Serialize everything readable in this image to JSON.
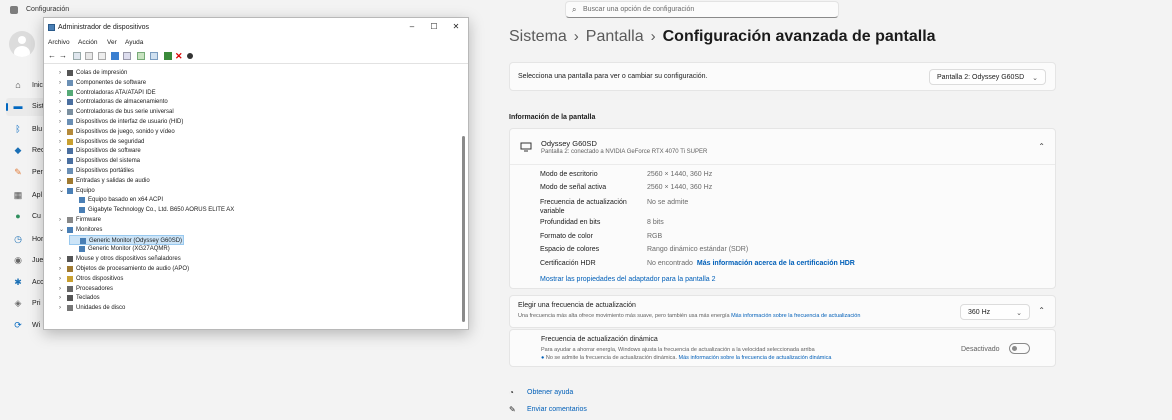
{
  "app": {
    "title": "Configuración"
  },
  "search": {
    "placeholder": "Buscar una opción de configuración"
  },
  "nav": [
    {
      "label": "Inic",
      "icon": "home-icon"
    },
    {
      "label": "Sist",
      "icon": "system-icon"
    },
    {
      "label": "Blu",
      "icon": "bluetooth-icon"
    },
    {
      "label": "Red",
      "icon": "network-icon"
    },
    {
      "label": "Per",
      "icon": "personalization-icon"
    },
    {
      "label": "Apl",
      "icon": "apps-icon"
    },
    {
      "label": "Cu",
      "icon": "accounts-icon"
    },
    {
      "label": "Hor",
      "icon": "time-icon"
    },
    {
      "label": "Jue",
      "icon": "gaming-icon"
    },
    {
      "label": "Acc",
      "icon": "accessibility-icon"
    },
    {
      "label": "Pri",
      "icon": "privacy-icon"
    },
    {
      "label": "Wi",
      "icon": "windows-update-icon"
    }
  ],
  "breadcrumb": {
    "c1": "Sistema",
    "c2": "Pantalla",
    "c3": "Configuración avanzada de pantalla",
    "sep": "›"
  },
  "select_display": {
    "text": "Selecciona una pantalla para ver o cambiar su configuración.",
    "value": "Pantalla 2: Odyssey G60SD"
  },
  "display_info": {
    "heading": "Información de la pantalla",
    "monitor_name": "Odyssey G60SD",
    "monitor_sub": "Pantalla 2: conectado a NVIDIA GeForce RTX 4070 Ti SUPER",
    "rows": [
      {
        "label": "Modo de escritorio",
        "value": "2560 × 1440, 360 Hz"
      },
      {
        "label": "Modo de señal activa",
        "value": "2560 × 1440, 360 Hz"
      },
      {
        "label": "Frecuencia de actualización",
        "label2": "variable",
        "value": "No se admite"
      },
      {
        "label": "Profundidad en bits",
        "value": "8 bits"
      },
      {
        "label": "Formato de color",
        "value": "RGB"
      },
      {
        "label": "Espacio de colores",
        "value": "Rango dinámico estándar (SDR)"
      },
      {
        "label": "Certificación HDR",
        "value": "No encontrado",
        "link": "Más información acerca de la certificación HDR"
      }
    ],
    "adapter_link": "Mostrar las propiedades del adaptador para la pantalla 2"
  },
  "refresh": {
    "title": "Elegir una frecuencia de actualización",
    "desc": "Una frecuencia más alta ofrece movimiento más suave, pero también usa más energía",
    "desc_link": "Más información sobre la frecuencia de actualización",
    "value": "360 Hz",
    "dynamic_title": "Frecuencia de actualización dinámica",
    "dynamic_desc": "Para ayudar a ahorrar energía, Windows ajusta la frecuencia de actualización a la velocidad seleccionada arriba",
    "dynamic_note": "No se admite la frecuencia de actualización dinámica.",
    "dynamic_link": "Más información sobre la frecuencia de actualización dinámica",
    "toggle_label": "Desactivado"
  },
  "footer": {
    "help": "Obtener ayuda",
    "feedback": "Enviar comentarios"
  },
  "device_manager": {
    "title": "Administrador de dispositivos",
    "menu": [
      "Archivo",
      "Acción",
      "Ver",
      "Ayuda"
    ],
    "tree": [
      {
        "label": "Colas de impresión",
        "level": 1,
        "exp": ">"
      },
      {
        "label": "Componentes de software",
        "level": 1,
        "exp": ">"
      },
      {
        "label": "Controladoras ATA/ATAPI IDE",
        "level": 1,
        "exp": ">"
      },
      {
        "label": "Controladoras de almacenamiento",
        "level": 1,
        "exp": ">"
      },
      {
        "label": "Controladoras de bus serie universal",
        "level": 1,
        "exp": ">"
      },
      {
        "label": "Dispositivos de interfaz de usuario (HID)",
        "level": 1,
        "exp": ">"
      },
      {
        "label": "Dispositivos de juego, sonido y vídeo",
        "level": 1,
        "exp": ">"
      },
      {
        "label": "Dispositivos de seguridad",
        "level": 1,
        "exp": ">"
      },
      {
        "label": "Dispositivos de software",
        "level": 1,
        "exp": ">"
      },
      {
        "label": "Dispositivos del sistema",
        "level": 1,
        "exp": ">"
      },
      {
        "label": "Dispositivos portátiles",
        "level": 1,
        "exp": ">"
      },
      {
        "label": "Entradas y salidas de audio",
        "level": 1,
        "exp": ">"
      },
      {
        "label": "Equipo",
        "level": 1,
        "exp": "v"
      },
      {
        "label": "Equipo basado en x64 ACPI",
        "level": 2,
        "exp": ""
      },
      {
        "label": "Gigabyte Technology Co., Ltd. B650 AORUS ELITE AX",
        "level": 2,
        "exp": ""
      },
      {
        "label": "Firmware",
        "level": 1,
        "exp": ">"
      },
      {
        "label": "Monitores",
        "level": 1,
        "exp": "v"
      },
      {
        "label": "Generic Monitor (Odyssey G60SD)",
        "level": 2,
        "exp": "",
        "selected": true
      },
      {
        "label": "Generic Monitor (XG27AQMR)",
        "level": 2,
        "exp": ""
      },
      {
        "label": "Mouse y otros dispositivos señaladores",
        "level": 1,
        "exp": ">"
      },
      {
        "label": "Objetos de procesamiento de audio (APO)",
        "level": 1,
        "exp": ">"
      },
      {
        "label": "Otros dispositivos",
        "level": 1,
        "exp": ">"
      },
      {
        "label": "Procesadores",
        "level": 1,
        "exp": ">"
      },
      {
        "label": "Teclados",
        "level": 1,
        "exp": ">"
      },
      {
        "label": "Unidades de disco",
        "level": 1,
        "exp": ">"
      }
    ]
  },
  "colors": {
    "accent": "#005fb8",
    "selected_bg": "#cce4f7"
  }
}
